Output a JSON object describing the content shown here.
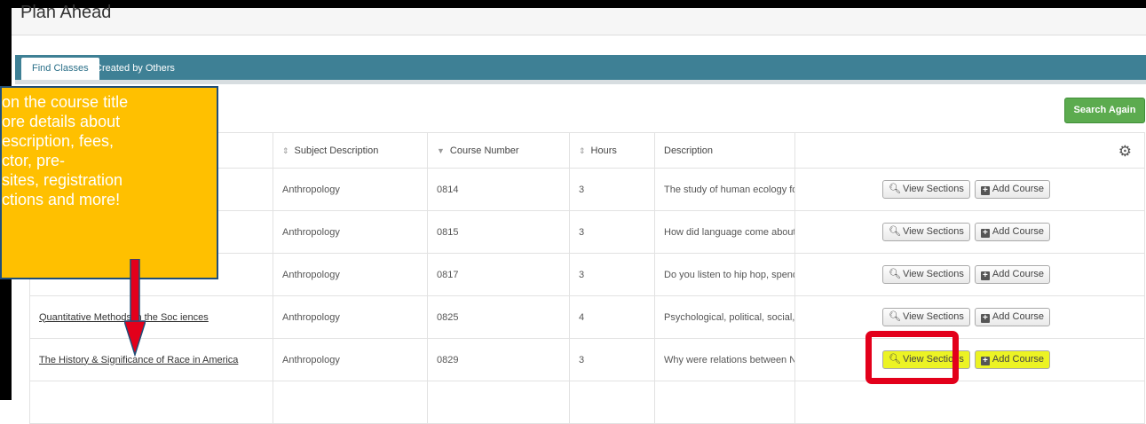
{
  "page_title": "Plan Ahead",
  "tabs": [
    {
      "label": "Find Classes"
    },
    {
      "label": "Created by Others"
    }
  ],
  "search_again_label": "Search Again",
  "table": {
    "headers": {
      "subject": "Subject Description",
      "number": "Course Number",
      "hours": "Hours",
      "description": "Description"
    },
    "rows": [
      {
        "title": "",
        "subject": "Anthropology",
        "number": "0814",
        "hours": "3",
        "description": "The study of human ecology focuses ...",
        "view": "View Sections",
        "add": "Add Course"
      },
      {
        "title": "",
        "subject": "Anthropology",
        "number": "0815",
        "hours": "3",
        "description": "How did language come about? How ...",
        "view": "View Sections",
        "add": "Add Course"
      },
      {
        "title": "",
        "subject": "Anthropology",
        "number": "0817",
        "hours": "3",
        "description": "Do you listen to hip hop, spend all yo...",
        "view": "View Sections",
        "add": "Add Course"
      },
      {
        "title": "Quantitative Methods in the Soc   iences",
        "subject": "Anthropology",
        "number": "0825",
        "hours": "4",
        "description": "Psychological, political, social, and ec...",
        "view": "View Sections",
        "add": "Add Course"
      },
      {
        "title": "The History & Significance of Race in America",
        "subject": "Anthropology",
        "number": "0829",
        "hours": "3",
        "description": "Why were relations between Native A...",
        "view": "View Sections",
        "add": "Add Course"
      }
    ]
  },
  "callout": {
    "lines": [
      "on the course title",
      "ore details about",
      "escription, fees,",
      "ctor, pre-",
      "sites, registration",
      "ctions and more!"
    ]
  },
  "colors": {
    "tab_bar": "#3e8095",
    "search_button": "#5cab4f",
    "callout_fill": "#ffc000",
    "callout_border": "#1f4e79",
    "annotation_red": "#e3001b",
    "highlight_yellow": "#ecf324"
  }
}
